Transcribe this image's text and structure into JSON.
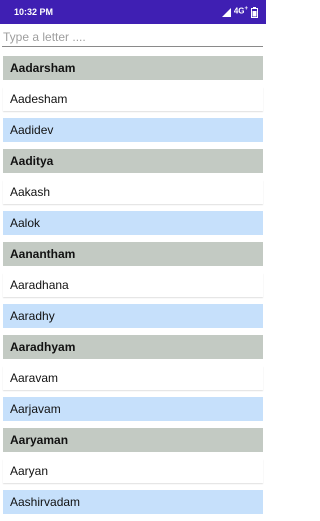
{
  "status_bar": {
    "time": "10:32 PM",
    "network": "4G",
    "network_sup": "+",
    "background": "#3f1fb3"
  },
  "search": {
    "placeholder": "Type a letter ...."
  },
  "colors": {
    "gray": "#c3cac3",
    "white": "#ffffff",
    "blue": "#c6e0fb"
  },
  "names": [
    {
      "label": "Aadarsham",
      "style": "gray"
    },
    {
      "label": "Aadesham",
      "style": "white"
    },
    {
      "label": "Aadidev",
      "style": "blue"
    },
    {
      "label": "Aaditya",
      "style": "gray"
    },
    {
      "label": "Aakash",
      "style": "white"
    },
    {
      "label": "Aalok",
      "style": "blue"
    },
    {
      "label": "Aanantham",
      "style": "gray"
    },
    {
      "label": "Aaradhana",
      "style": "white"
    },
    {
      "label": "Aaradhy",
      "style": "blue"
    },
    {
      "label": "Aaradhyam",
      "style": "gray"
    },
    {
      "label": "Aaravam",
      "style": "white"
    },
    {
      "label": "Aarjavam",
      "style": "blue"
    },
    {
      "label": "Aaryaman",
      "style": "gray"
    },
    {
      "label": "Aaryan",
      "style": "white"
    },
    {
      "label": "Aashirvadam",
      "style": "blue"
    }
  ]
}
